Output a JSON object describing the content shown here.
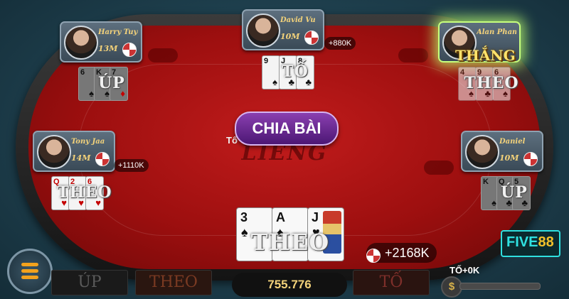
{
  "table": {
    "logo": "LIENG",
    "label": "Tổ",
    "deal_button": "CHIA BÀI",
    "pot": "755.776"
  },
  "players": {
    "harry": {
      "name": "Harry Tuyen",
      "money": "13M",
      "action": "ÚP",
      "gain": ""
    },
    "david": {
      "name": "David Vu",
      "money": "10M",
      "action": "TỐ",
      "gain": "+880K"
    },
    "alan": {
      "name": "Alan Pham",
      "money": "",
      "action": "THEO",
      "gain": "",
      "status": "THẮNG"
    },
    "tony": {
      "name": "Tony Jaa",
      "money": "14M",
      "action": "THEO",
      "gain": "+1110K"
    },
    "daniel": {
      "name": "Daniel",
      "money": "10M",
      "action": "ÚP",
      "gain": ""
    }
  },
  "hands": {
    "harry": [
      {
        "rank": "6",
        "suit": "♠"
      },
      {
        "rank": "K",
        "suit": "♠"
      },
      {
        "rank": "7",
        "suit": "♦"
      }
    ],
    "david": [
      {
        "rank": "9",
        "suit": "♠"
      },
      {
        "rank": "J",
        "suit": "♣"
      },
      {
        "rank": "8",
        "suit": "♣"
      }
    ],
    "alan": [
      {
        "rank": "4",
        "suit": "♠"
      },
      {
        "rank": "9",
        "suit": "♣"
      },
      {
        "rank": "6",
        "suit": "♠"
      }
    ],
    "tony": [
      {
        "rank": "Q",
        "suit": "♥"
      },
      {
        "rank": "2",
        "suit": "♥"
      },
      {
        "rank": "6",
        "suit": "♥"
      }
    ],
    "daniel": [
      {
        "rank": "K",
        "suit": "♠"
      },
      {
        "rank": "Q",
        "suit": "♣"
      },
      {
        "rank": "5",
        "suit": "♣"
      }
    ],
    "me": [
      {
        "rank": "3",
        "suit": "♠"
      },
      {
        "rank": "A",
        "suit": "♠"
      },
      {
        "rank": "J",
        "suit": "♥"
      }
    ]
  },
  "me": {
    "action": "THEO",
    "gain": "+2168K"
  },
  "controls": {
    "fold": "ÚP",
    "call": "THEO",
    "raise": "TỐ",
    "raise_amount": "TỐ+0K",
    "coin": "$"
  },
  "brand": {
    "part1": "FIVE",
    "part2": "88"
  },
  "colors": {
    "felt": "#b31515",
    "gold": "#f3d27a",
    "deal": "#6a2a94",
    "win_glow": "#c7ff7d",
    "brand": "#2fe0e0"
  },
  "icons": {
    "menu": "menu-icon",
    "chip": "chip-icon",
    "coin": "coin-icon"
  }
}
